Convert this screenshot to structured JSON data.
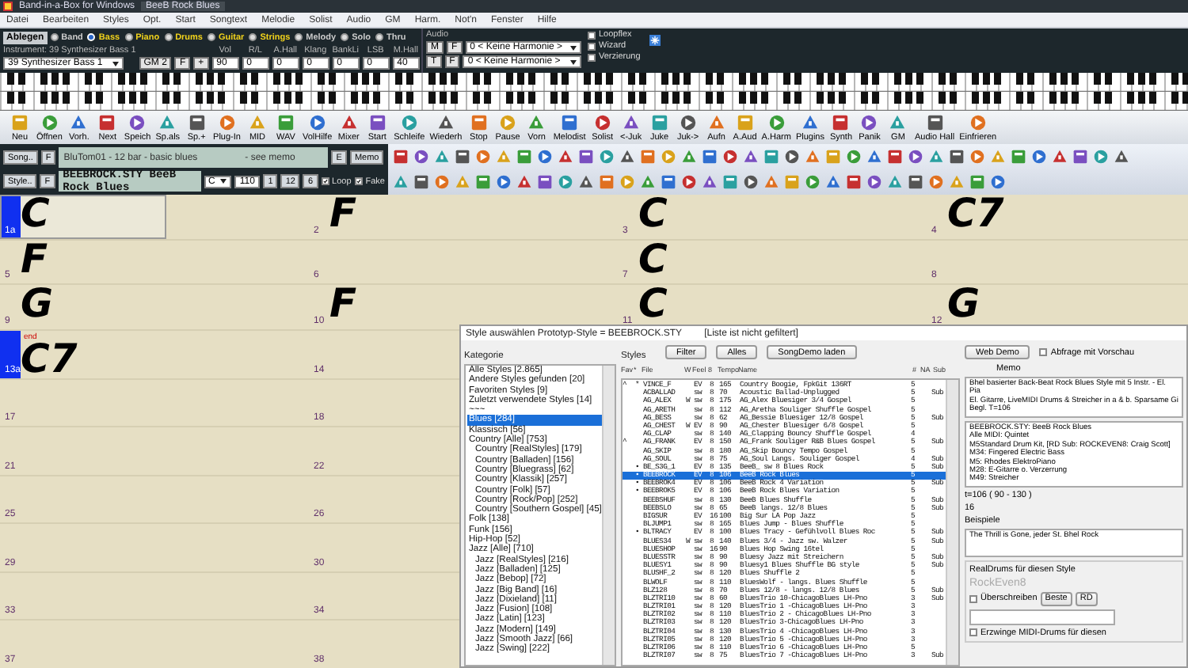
{
  "window": {
    "title": "Band-in-a-Box for Windows",
    "document": "BeeB Rock Blues"
  },
  "menu": [
    "Datei",
    "Bearbeiten",
    "Styles",
    "Opt.",
    "Start",
    "Songtext",
    "Melodie",
    "Solist",
    "Audio",
    "GM",
    "Harm.",
    "Not'n",
    "Fenster",
    "Hilfe"
  ],
  "tracks": {
    "button": "Ablegen",
    "audio": "Audio",
    "items": [
      {
        "label": "Band",
        "selected": false,
        "used": false
      },
      {
        "label": "Bass",
        "selected": true,
        "used": true
      },
      {
        "label": "Piano",
        "selected": false,
        "used": true
      },
      {
        "label": "Drums",
        "selected": false,
        "used": true
      },
      {
        "label": "Guitar",
        "selected": false,
        "used": true
      },
      {
        "label": "Strings",
        "selected": false,
        "used": true
      },
      {
        "label": "Melody",
        "selected": false,
        "used": false
      },
      {
        "label": "Solo",
        "selected": false,
        "used": false
      },
      {
        "label": "Thru",
        "selected": false,
        "used": false
      }
    ]
  },
  "instrument": {
    "caption": "Instrument: 39 Synthesizer Bass 1",
    "patch": "39 Synthesizer Bass 1",
    "bank": "GM 2",
    "f": "F",
    "plus": "+",
    "params": [
      {
        "label": "Vol",
        "value": "90"
      },
      {
        "label": "R/L",
        "value": "0"
      },
      {
        "label": "A.Hall",
        "value": "0"
      },
      {
        "label": "Klang",
        "value": "0"
      },
      {
        "label": "BankLi",
        "value": "0"
      },
      {
        "label": "LSB",
        "value": "0"
      },
      {
        "label": "M.Hall",
        "value": "40"
      }
    ]
  },
  "harmony": [
    {
      "key": "M",
      "f": "F",
      "value": "0 < Keine Harmonie >"
    },
    {
      "key": "T",
      "f": "F",
      "value": "0 < Keine Harmonie >"
    }
  ],
  "options": [
    {
      "label": "Loopflex",
      "checked": false
    },
    {
      "label": "Wizard",
      "checked": false
    },
    {
      "label": "Verzierung",
      "checked": false
    }
  ],
  "toolbar": [
    "Neu",
    "Öffnen",
    "Vorh.",
    "Next",
    "Speich",
    "Sp.als",
    "Sp.+",
    "Plug-In",
    "MID",
    "WAV",
    "VolHilfe",
    "Mixer",
    "Start",
    "Schleife",
    "Wiederh",
    "Stop",
    "Pause",
    "Vorn",
    "Melodist",
    "Solist",
    "<-Juk",
    "Juke",
    "Juk->",
    "Aufn",
    "A.Aud",
    "A.Harm",
    "Plugins",
    "Synth",
    "Panik",
    "GM",
    "Audio Hall",
    "Einfrieren"
  ],
  "song": {
    "song_button": "Song..",
    "style_button": "Style..",
    "f": "F",
    "style_f": "F",
    "title": "BluTom01 - 12 bar - basic blues",
    "note": "- see memo",
    "e": "E",
    "memo": "Memo",
    "style": "BEEBROCK.STY BeeB Rock Blues",
    "key": "C",
    "tempo": "110",
    "counts": [
      "1",
      "12",
      "6"
    ],
    "checks": [
      {
        "label": "Loop",
        "checked": true
      },
      {
        "label": "Fake",
        "checked": true
      }
    ]
  },
  "grid": {
    "rows": [
      {
        "cells": [
          {
            "bar": "1a",
            "chord": "C",
            "selected": true,
            "marker": true
          },
          {
            "bar": "2",
            "chord": "F",
            "selected": false,
            "marker": false
          },
          {
            "bar": "3",
            "chord": "C",
            "selected": false,
            "marker": false
          },
          {
            "bar": "4",
            "chord": "C7",
            "selected": false,
            "marker": false
          }
        ]
      },
      {
        "cells": [
          {
            "bar": "5",
            "chord": "F",
            "selected": false,
            "marker": false
          },
          {
            "bar": "6",
            "selected": false,
            "marker": false
          },
          {
            "bar": "7",
            "chord": "C",
            "selected": false,
            "marker": false
          },
          {
            "bar": "8",
            "selected": false,
            "marker": false
          }
        ]
      },
      {
        "cells": [
          {
            "bar": "9",
            "chord": "G",
            "selected": false,
            "marker": false
          },
          {
            "bar": "10",
            "chord": "F",
            "selected": false,
            "marker": false
          },
          {
            "bar": "11",
            "chord": "C",
            "selected": false,
            "marker": false
          },
          {
            "bar": "12",
            "chord": "G",
            "selected": false,
            "marker": false
          }
        ]
      },
      {
        "cells": [
          {
            "bar": "13a",
            "chord": "C7",
            "end": "end",
            "selected": false,
            "marker": true
          },
          {
            "bar": "14",
            "selected": false,
            "marker": false
          }
        ]
      },
      {
        "cells": [
          {
            "bar": "17",
            "selected": false,
            "marker": false
          },
          {
            "bar": "18",
            "selected": false,
            "marker": false
          }
        ]
      },
      {
        "cells": [
          {
            "bar": "21",
            "selected": false,
            "marker": false
          },
          {
            "bar": "22",
            "selected": false,
            "marker": false
          }
        ]
      },
      {
        "cells": [
          {
            "bar": "25",
            "selected": false,
            "marker": false
          },
          {
            "bar": "26",
            "selected": false,
            "marker": false
          }
        ]
      },
      {
        "cells": [
          {
            "bar": "29",
            "selected": false,
            "marker": false
          },
          {
            "bar": "30",
            "selected": false,
            "marker": false
          }
        ]
      },
      {
        "cells": [
          {
            "bar": "33",
            "selected": false,
            "marker": false
          },
          {
            "bar": "34",
            "selected": false,
            "marker": false
          }
        ]
      },
      {
        "cells": [
          {
            "bar": "37",
            "selected": false,
            "marker": false
          },
          {
            "bar": "38",
            "selected": false,
            "marker": false
          }
        ]
      }
    ]
  },
  "dialog": {
    "title": "Style auswählen Prototyp-Style = BEEBROCK.STY",
    "filter_note": "[Liste ist nicht gefiltert]",
    "category_label": "Kategorie",
    "styles_label": "Styles",
    "buttons": [
      "Filter",
      "Alles",
      "SongDemo laden",
      "Web Demo"
    ],
    "preview": {
      "label": "Abfrage mit Vorschau",
      "checked": false
    },
    "memo_label": "Memo",
    "categories": [
      {
        "label": "Alle Styles [2.865]",
        "selected": false
      },
      {
        "label": "Andere Styles gefunden [20]",
        "selected": false
      },
      {
        "label": "Favoriten Styles [9]",
        "selected": false
      },
      {
        "label": "Zuletzt verwendete Styles [14]",
        "selected": false
      },
      {
        "label": "~~~",
        "selected": false
      },
      {
        "label": "Blues [284]",
        "selected": true
      },
      {
        "label": "Klassisch [56]",
        "selected": false
      },
      {
        "label": "Country [Alle] [753]",
        "selected": false,
        "children": [
          {
            "label": "Country [RealStyles] [179]",
            "selected": false
          },
          {
            "label": "Country [Balladen] [156]",
            "selected": false
          },
          {
            "label": "Country [Bluegrass] [62]",
            "selected": false
          },
          {
            "label": "Country [Klassik] [257]",
            "selected": false
          },
          {
            "label": "Country [Folk] [57]",
            "selected": false
          },
          {
            "label": "Country [Rock/Pop] [252]",
            "selected": false
          },
          {
            "label": "Country [Southern Gospel] [45]",
            "selected": false
          }
        ]
      },
      {
        "label": "Folk [138]",
        "selected": false
      },
      {
        "label": "Funk [156]",
        "selected": false
      },
      {
        "label": "Hip-Hop [52]",
        "selected": false
      },
      {
        "label": "Jazz [Alle] [710]",
        "selected": false,
        "children": [
          {
            "label": "Jazz [RealStyles] [216]",
            "selected": false
          },
          {
            "label": "Jazz [Balladen] [125]",
            "selected": false
          },
          {
            "label": "Jazz [Bebop] [72]",
            "selected": false
          },
          {
            "label": "Jazz [Big Band] [16]",
            "selected": false
          },
          {
            "label": "Jazz [Dixieland] [11]",
            "selected": false
          },
          {
            "label": "Jazz [Fusion] [108]",
            "selected": false
          },
          {
            "label": "Jazz [Latin] [123]",
            "selected": false
          },
          {
            "label": "Jazz [Modern] [149]",
            "selected": false
          },
          {
            "label": "Jazz [Smooth Jazz] [66]",
            "selected": false
          },
          {
            "label": "Jazz [Swing] [222]",
            "selected": false
          }
        ]
      }
    ],
    "columns": [
      "Fav",
      "*",
      "File",
      "W",
      "Feel",
      "8",
      "Tempo",
      "Name",
      "#",
      "NA",
      "Sub"
    ],
    "styles": [
      {
        "fav": "^",
        "mark": "*",
        "file": "VINCE_F",
        "feel": "EV",
        "eighths": "8",
        "tempo": "165",
        "name": "Country Boogie, FpkGit 136RT",
        "count": "5",
        "selected": false
      },
      {
        "file": "ACBALLAD",
        "feel": "sw",
        "eighths": "8",
        "tempo": "70",
        "name": "Acoustic Ballad-Unplugged",
        "count": "5",
        "sub": "Sub",
        "selected": false
      },
      {
        "file": "AG_ALEX",
        "w": "W",
        "feel": "sw",
        "eighths": "8",
        "tempo": "175",
        "name": "AG_Alex Bluesiger 3/4 Gospel",
        "count": "5",
        "selected": false
      },
      {
        "file": "AG_ARETH",
        "feel": "sw",
        "eighths": "8",
        "tempo": "112",
        "name": "AG_Aretha Souliger Shuffle Gospel",
        "count": "5",
        "selected": false
      },
      {
        "file": "AG_BESS",
        "feel": "sw",
        "eighths": "8",
        "tempo": "62",
        "name": "AG_Bessie Bluesiger 12/8 Gospel",
        "count": "5",
        "sub": "Sub",
        "selected": false
      },
      {
        "file": "AG_CHEST",
        "w": "W",
        "feel": "EV",
        "eighths": "8",
        "tempo": "90",
        "name": "AG_Chester Bluesiger 6/8 Gospel",
        "count": "5",
        "selected": false
      },
      {
        "file": "AG_CLAP",
        "feel": "sw",
        "eighths": "8",
        "tempo": "140",
        "name": "AG_Clapping Bouncy Shuffle Gospel",
        "count": "4",
        "selected": false
      },
      {
        "fav": "^",
        "file": "AG_FRANK",
        "feel": "EV",
        "eighths": "8",
        "tempo": "150",
        "name": "AG_Frank Souliger R&B Blues Gospel",
        "count": "5",
        "sub": "Sub",
        "selected": false
      },
      {
        "file": "AG_SKIP",
        "feel": "sw",
        "eighths": "8",
        "tempo": "180",
        "name": "AG_Skip Bouncy Tempo Gospel",
        "count": "5",
        "selected": false
      },
      {
        "file": "AG_SOUL",
        "feel": "sw",
        "eighths": "8",
        "tempo": "75",
        "name": "AG_Soul Langs. Souliger Gospel",
        "count": "4",
        "sub": "Sub",
        "selected": false
      },
      {
        "mark": "•",
        "file": "BE_S3G_1",
        "feel": "EV",
        "eighths": "8",
        "tempo": "135",
        "name": "BeeB_ sw 8 Blues Rock",
        "count": "5",
        "sub": "Sub",
        "selected": false
      },
      {
        "mark": "•",
        "file": "BEEBROCK",
        "feel": "EV",
        "eighths": "8",
        "tempo": "106",
        "name": "BeeB Rock Blues",
        "count": "5",
        "selected": true
      },
      {
        "mark": "•",
        "file": "BEEBROK4",
        "feel": "EV",
        "eighths": "8",
        "tempo": "106",
        "name": "BeeB Rock 4 Variation",
        "count": "5",
        "sub": "Sub",
        "selected": false
      },
      {
        "mark": "•",
        "file": "BEEBROK5",
        "feel": "EV",
        "eighths": "8",
        "tempo": "106",
        "name": "BeeB Rock Blues Variation",
        "count": "5",
        "selected": false
      },
      {
        "file": "BEEBSHUF",
        "feel": "sw",
        "eighths": "8",
        "tempo": "130",
        "name": "BeeB Blues Shuffle",
        "count": "5",
        "sub": "Sub",
        "selected": false
      },
      {
        "file": "BEEBSLO",
        "feel": "sw",
        "eighths": "8",
        "tempo": "65",
        "name": "BeeB langs. 12/8 Blues",
        "count": "5",
        "sub": "Sub",
        "selected": false
      },
      {
        "file": "BIGSUR",
        "feel": "EV",
        "eighths": "16",
        "tempo": "100",
        "name": "Big Sur LA Pop Jazz",
        "count": "5",
        "selected": false
      },
      {
        "file": "BLJUMP1",
        "feel": "sw",
        "eighths": "8",
        "tempo": "165",
        "name": "Blues Jump - Blues Shuffle",
        "count": "5",
        "selected": false
      },
      {
        "mark": "•",
        "file": "BLTRACY",
        "feel": "EV",
        "eighths": "8",
        "tempo": "100",
        "name": "Blues Tracy - Gefühlvoll Blues Roc",
        "count": "5",
        "sub": "Sub",
        "selected": false
      },
      {
        "file": "BLUES34",
        "w": "W",
        "feel": "sw",
        "eighths": "8",
        "tempo": "140",
        "name": "Blues 3/4 - Jazz sw. Walzer",
        "count": "5",
        "sub": "Sub",
        "selected": false
      },
      {
        "file": "BLUESHOP",
        "feel": "sw",
        "eighths": "16",
        "tempo": "90",
        "name": "Blues Hop Swing 16tel",
        "count": "5",
        "selected": false
      },
      {
        "file": "BLUESSTR",
        "feel": "sw",
        "eighths": "8",
        "tempo": "90",
        "name": "Bluesy Jazz mit Streichern",
        "count": "5",
        "sub": "Sub",
        "selected": false
      },
      {
        "file": "BLUESY1",
        "feel": "sw",
        "eighths": "8",
        "tempo": "90",
        "name": "Bluesy1 Blues Shuffle BG style",
        "count": "5",
        "sub": "Sub",
        "selected": false
      },
      {
        "file": "BLUSHF_2",
        "feel": "sw",
        "eighths": "8",
        "tempo": "120",
        "name": "Blues Shuffle 2",
        "count": "5",
        "selected": false
      },
      {
        "file": "BLWOLF",
        "feel": "sw",
        "eighths": "8",
        "tempo": "110",
        "name": "BluesWolf - langs. Blues Shuffle",
        "count": "5",
        "selected": false
      },
      {
        "file": "BLZ128",
        "feel": "sw",
        "eighths": "8",
        "tempo": "70",
        "name": "Blues 12/8 - langs. 12/8 Blues",
        "count": "5",
        "sub": "Sub",
        "selected": false
      },
      {
        "file": "BLZTRI10",
        "feel": "sw",
        "eighths": "8",
        "tempo": "60",
        "name": "BluesTrio 10-ChicagoBlues LH-Pno",
        "count": "3",
        "sub": "Sub",
        "selected": false
      },
      {
        "file": "BLZTRI01",
        "feel": "sw",
        "eighths": "8",
        "tempo": "120",
        "name": "BluesTrio 1 -ChicagoBlues LH-Pno",
        "count": "3",
        "selected": false
      },
      {
        "file": "BLZTRI02",
        "feel": "sw",
        "eighths": "8",
        "tempo": "110",
        "name": "BluesTrio 2 - ChicagoBlues LH-Pno",
        "count": "3",
        "selected": false
      },
      {
        "file": "BLZTRI03",
        "feel": "sw",
        "eighths": "8",
        "tempo": "120",
        "name": "BluesTrio 3-ChicagoBlues LH-Pno",
        "count": "3",
        "selected": false
      },
      {
        "file": "BLZTRI04",
        "feel": "sw",
        "eighths": "8",
        "tempo": "130",
        "name": "BluesTrio 4 -ChicagoBlues LH-Pno",
        "count": "3",
        "selected": false
      },
      {
        "file": "BLZTRI05",
        "feel": "sw",
        "eighths": "8",
        "tempo": "120",
        "name": "BluesTrio 5 -ChicagoBlues LH-Pno",
        "count": "3",
        "selected": false
      },
      {
        "file": "BLZTRI06",
        "feel": "sw",
        "eighths": "8",
        "tempo": "110",
        "name": "BluesTrio 6 -ChicagoBlues LH-Pno",
        "count": "5",
        "selected": false
      },
      {
        "file": "BLZTRI07",
        "feel": "sw",
        "eighths": "8",
        "tempo": "75",
        "name": "BluesTrio 7 -ChicagoBlues LH-Pno",
        "count": "3",
        "sub": "Sub",
        "selected": false
      }
    ],
    "memo": [
      "Bhel basierter Back-Beat Rock Blues Style mit 5 Instr. - El. Pia",
      "El. Gitarre, LiveMIDI Drums & Streicher in a & b. Sparsame Gi",
      "Begl. T=106"
    ],
    "info": [
      "BEEBROCK.STY: BeeB Rock Blues",
      "Alle MIDI: Quintet",
      "M5Standard Drum Kit, [RD Sub: ROCKEVEN8: Craig Scott]",
      "M34: Fingered Electric Bass",
      "M5: Rhodes ElektroPiano",
      "M28: E-Gitarre o. Verzerrung",
      "M49: Streicher"
    ],
    "tempo": "t=106 ( 90 - 130 )",
    "feel": "16",
    "examples_label": "Beispiele",
    "examples": "The Thrill is Gone, jeder St. Bhel Rock",
    "realdrums": {
      "label": "RealDrums für diesen Style",
      "name": "RockEven8",
      "override": {
        "label": "Überschreiben",
        "checked": false
      },
      "buttons": [
        "Beste",
        "RD"
      ],
      "force": {
        "label": "Erzwinge MIDI-Drums für diesen",
        "checked": false
      }
    }
  }
}
